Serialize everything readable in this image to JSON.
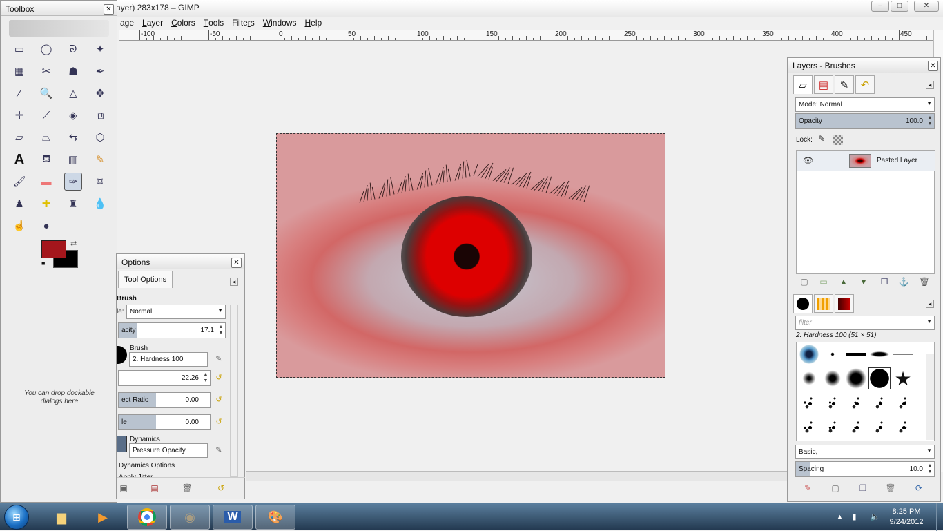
{
  "window": {
    "title": "ayer) 283x178 – GIMP",
    "min_label": "–",
    "max_label": "□",
    "close_label": "✕"
  },
  "menu": [
    {
      "pre": "",
      "u": "",
      "post": "age"
    },
    {
      "pre": "",
      "u": "L",
      "post": "ayer"
    },
    {
      "pre": "",
      "u": "C",
      "post": "olors"
    },
    {
      "pre": "",
      "u": "T",
      "post": "ools"
    },
    {
      "pre": "Filte",
      "u": "r",
      "post": "s"
    },
    {
      "pre": "",
      "u": "W",
      "post": "indows"
    },
    {
      "pre": "",
      "u": "H",
      "post": "elp"
    }
  ],
  "ruler": {
    "labels": [
      "-100",
      "-50",
      "0",
      "50",
      "100",
      "150",
      "200",
      "250",
      "300",
      "350",
      "400",
      "450"
    ]
  },
  "toolbox": {
    "title": "Toolbox",
    "close": "✕",
    "drop_message": "You can drop dockable dialogs here",
    "fg_color": "#a4161c",
    "bg_color": "#000000"
  },
  "tool_options": {
    "title": "Options",
    "tab": "Tool Options",
    "section": "Brush",
    "mode_label": "le:",
    "mode_value": "Normal",
    "opacity_label": "acity",
    "opacity_value": "17.1",
    "brush_label": "Brush",
    "brush_value": "2. Hardness 100",
    "size_value": "22.26",
    "aspect_label": "ect Ratio",
    "aspect_value": "0.00",
    "angle_label": "le",
    "angle_value": "0.00",
    "dynamics_label": "Dynamics",
    "dynamics_value": "Pressure Opacity",
    "dynamics_options": "Dynamics Options",
    "cut_text": "Apply Jitter"
  },
  "layers": {
    "title": "Layers - Brushes",
    "close": "✕",
    "mode_label": "Mode:",
    "mode_value": "Normal",
    "opacity_label": "Opacity",
    "opacity_value": "100.0",
    "lock_label": "Lock:",
    "layer_name": "Pasted Layer",
    "brush_filter_placeholder": "filter",
    "brush_name": "2. Hardness 100 (51 × 51)",
    "brush_tag": "Basic,",
    "spacing_label": "Spacing",
    "spacing_value": "10.0"
  },
  "taskbar": {
    "time": "8:25 PM",
    "date": "9/24/2012"
  }
}
